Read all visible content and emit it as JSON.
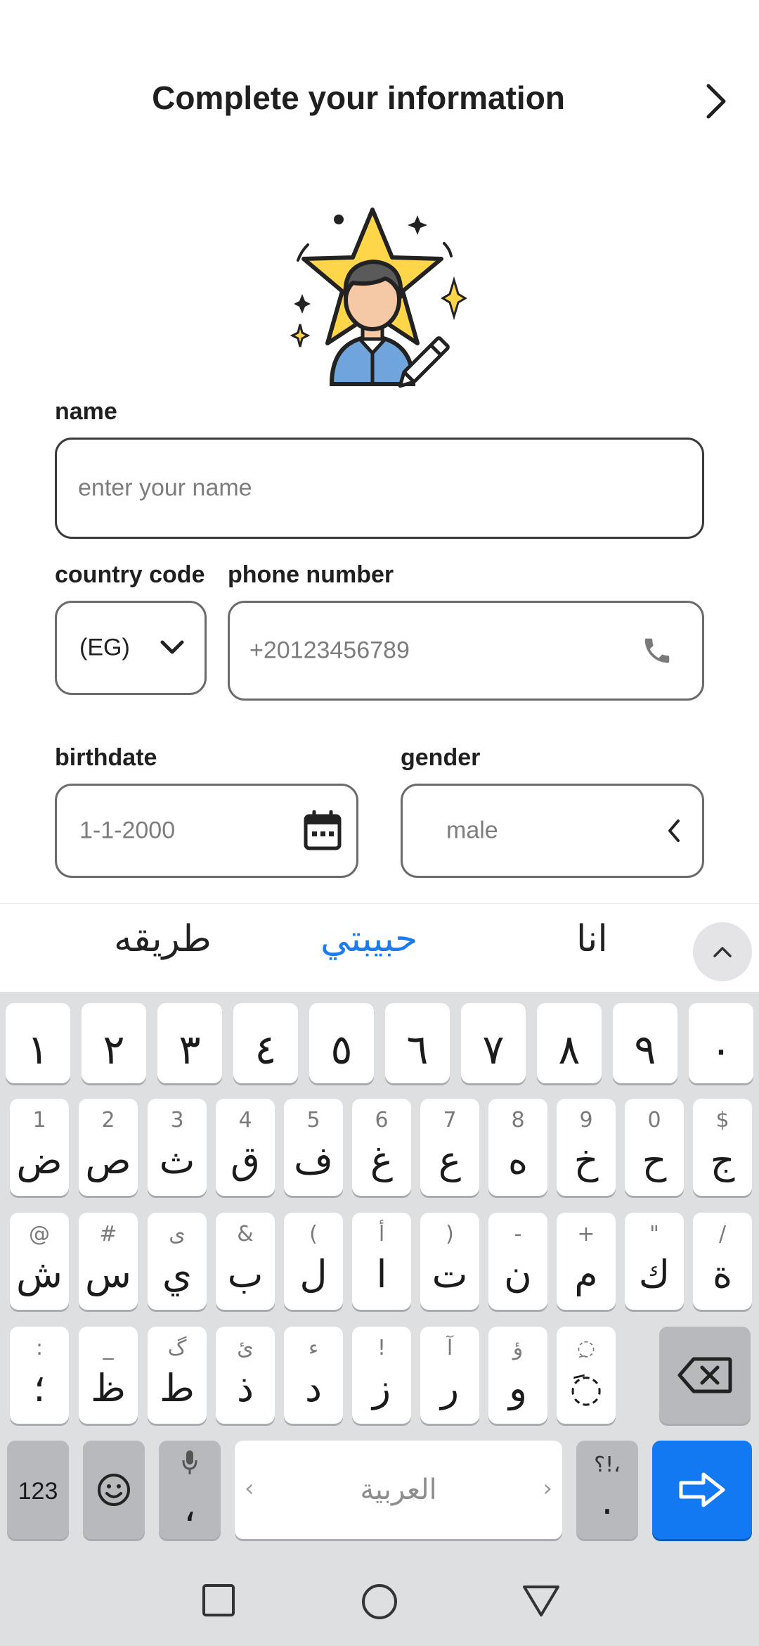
{
  "header": {
    "title": "Complete your information"
  },
  "form": {
    "name": {
      "label": "name",
      "placeholder": "enter your name"
    },
    "country_code": {
      "label": "country code",
      "value": "(EG)"
    },
    "phone": {
      "label": "phone number",
      "placeholder": "+20123456789"
    },
    "birthdate": {
      "label": "birthdate",
      "placeholder": "1-1-2000"
    },
    "gender": {
      "label": "gender",
      "placeholder": "male"
    }
  },
  "suggestions": {
    "left": "طريقه",
    "middle": "حبيبتي",
    "right": "انا"
  },
  "keyboard": {
    "numbers": [
      "١",
      "٢",
      "٣",
      "٤",
      "٥",
      "٦",
      "٧",
      "٨",
      "٩",
      "٠"
    ],
    "row1": [
      {
        "main": "ض",
        "sub": "1"
      },
      {
        "main": "ص",
        "sub": "2"
      },
      {
        "main": "ث",
        "sub": "3"
      },
      {
        "main": "ق",
        "sub": "4"
      },
      {
        "main": "ف",
        "sub": "5"
      },
      {
        "main": "غ",
        "sub": "6"
      },
      {
        "main": "ع",
        "sub": "7"
      },
      {
        "main": "ه",
        "sub": "8"
      },
      {
        "main": "خ",
        "sub": "9"
      },
      {
        "main": "ح",
        "sub": "0"
      },
      {
        "main": "ج",
        "sub": "$"
      }
    ],
    "row2": [
      {
        "main": "ش",
        "sub": "@"
      },
      {
        "main": "س",
        "sub": "#"
      },
      {
        "main": "ي",
        "sub": "ى"
      },
      {
        "main": "ب",
        "sub": "&"
      },
      {
        "main": "ل",
        "sub": "("
      },
      {
        "main": "ا",
        "sub": "أ"
      },
      {
        "main": "ت",
        "sub": ")"
      },
      {
        "main": "ن",
        "sub": "-"
      },
      {
        "main": "م",
        "sub": "+"
      },
      {
        "main": "ك",
        "sub": "\""
      },
      {
        "main": "ة",
        "sub": "/"
      }
    ],
    "row3": [
      {
        "main": "؛",
        "sub": ":"
      },
      {
        "main": "ظ",
        "sub": "_"
      },
      {
        "main": "ط",
        "sub": "گ"
      },
      {
        "main": "ذ",
        "sub": "ئ"
      },
      {
        "main": "د",
        "sub": "ء"
      },
      {
        "main": "ز",
        "sub": "!"
      },
      {
        "main": "ر",
        "sub": "آ"
      },
      {
        "main": "و",
        "sub": "ؤ"
      },
      {
        "main": "◌َ",
        "sub": "◌ِ"
      }
    ],
    "sym_key": "123",
    "comma_key": {
      "main": "،"
    },
    "space_label": "العربية",
    "period_key": {
      "main": ".",
      "sub": "؟!،"
    }
  }
}
